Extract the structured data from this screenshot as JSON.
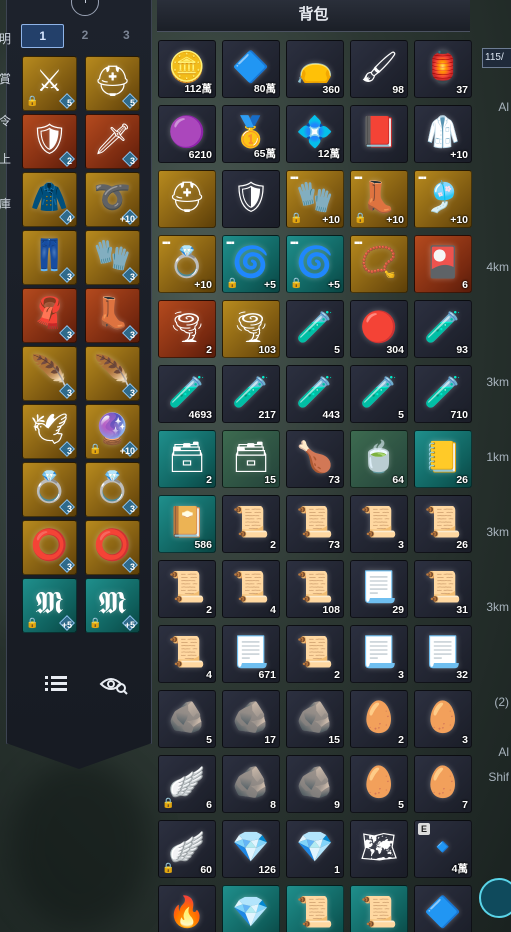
{
  "left": {
    "tabs": [
      {
        "label": "1",
        "active": true
      },
      {
        "label": "2",
        "active": false
      },
      {
        "label": "3",
        "active": false
      }
    ],
    "side_glyphs": [
      "明",
      "賞",
      "令",
      "上",
      "庫"
    ],
    "equipment": [
      {
        "icon": "spear-icon",
        "glyph": "⚔",
        "rarity": "gold",
        "gem": "5",
        "lock": true
      },
      {
        "icon": "helmet-icon",
        "glyph": "⛑",
        "rarity": "gold",
        "gem": "5",
        "lock": false
      },
      {
        "icon": "armor-icon",
        "glyph": "🛡",
        "rarity": "red",
        "gem": "2",
        "lock": false
      },
      {
        "icon": "gauntlet-icon",
        "glyph": "🗡",
        "rarity": "red",
        "gem": "3",
        "lock": false
      },
      {
        "icon": "chest-icon",
        "glyph": "🧥",
        "rarity": "gold",
        "gem": "4",
        "lock": false
      },
      {
        "icon": "belt-icon",
        "glyph": "➰",
        "rarity": "gold",
        "gem": "+10",
        "lock": false
      },
      {
        "icon": "pants-icon",
        "glyph": "👖",
        "rarity": "gold",
        "gem": "3",
        "lock": false
      },
      {
        "icon": "glove-icon",
        "glyph": "🧤",
        "rarity": "gold",
        "gem": "3",
        "lock": false
      },
      {
        "icon": "cape-icon",
        "glyph": "🧣",
        "rarity": "red",
        "gem": "3",
        "lock": false
      },
      {
        "icon": "boots-icon",
        "glyph": "👢",
        "rarity": "red",
        "gem": "3",
        "lock": false
      },
      {
        "icon": "wing-accessory-icon",
        "glyph": "🪶",
        "rarity": "gold",
        "gem": "3",
        "lock": false
      },
      {
        "icon": "wing-accessory-icon",
        "glyph": "🪶",
        "rarity": "gold",
        "gem": "3",
        "lock": false
      },
      {
        "icon": "wing-icon",
        "glyph": "🕊",
        "rarity": "gold",
        "gem": "3",
        "lock": false
      },
      {
        "icon": "orb-icon",
        "glyph": "🔮",
        "rarity": "gold",
        "gem": "+10",
        "lock": true
      },
      {
        "icon": "ring-icon",
        "glyph": "💍",
        "rarity": "gold",
        "gem": "3",
        "lock": false
      },
      {
        "icon": "ring-icon",
        "glyph": "💍",
        "rarity": "gold",
        "gem": "3",
        "lock": false
      },
      {
        "icon": "bracelet-icon",
        "glyph": "⭕",
        "rarity": "gold",
        "gem": "3",
        "lock": false
      },
      {
        "icon": "bracelet-icon",
        "glyph": "⭕",
        "rarity": "gold",
        "gem": "3",
        "lock": false
      },
      {
        "icon": "rune-icon",
        "glyph": "𝕸",
        "rarity": "teal",
        "gem": "+5",
        "lock": true
      },
      {
        "icon": "rune-icon",
        "glyph": "𝕸",
        "rarity": "teal",
        "gem": "+5",
        "lock": true
      }
    ]
  },
  "bag": {
    "title": "背包",
    "items": [
      {
        "icon": "gold-coin-icon",
        "glyph": "🪙",
        "rarity": "dark",
        "count": "112萬"
      },
      {
        "icon": "blue-coin-icon",
        "glyph": "🔷",
        "rarity": "dark",
        "count": "80萬"
      },
      {
        "icon": "pouch-icon",
        "glyph": "👝",
        "rarity": "dark",
        "count": "360"
      },
      {
        "icon": "brush-icon",
        "glyph": "🖌",
        "rarity": "dark",
        "count": "98"
      },
      {
        "icon": "lamp-icon",
        "glyph": "🏮",
        "rarity": "dark",
        "count": "37"
      },
      {
        "icon": "purple-coin-icon",
        "glyph": "🟣",
        "rarity": "dark",
        "count": "6210"
      },
      {
        "icon": "gold-shield-coin-icon",
        "glyph": "🥇",
        "rarity": "dark",
        "count": "65萬"
      },
      {
        "icon": "crystal-coin-icon",
        "glyph": "💠",
        "rarity": "dark",
        "count": "12萬"
      },
      {
        "icon": "red-book-icon",
        "glyph": "📕",
        "rarity": "dark",
        "count": ""
      },
      {
        "icon": "white-armor-icon",
        "glyph": "🥼",
        "rarity": "dark",
        "count": "+10"
      },
      {
        "icon": "helmet-icon",
        "glyph": "⛑",
        "rarity": "gold",
        "count": ""
      },
      {
        "icon": "chest-armor-icon",
        "glyph": "🛡",
        "rarity": "dark",
        "count": ""
      },
      {
        "icon": "gauntlet-icon",
        "glyph": "🧤",
        "rarity": "gold",
        "count": "+10",
        "lock": true,
        "dots": true
      },
      {
        "icon": "boots-icon",
        "glyph": "👢",
        "rarity": "gold",
        "count": "+10",
        "lock": true,
        "dots": true
      },
      {
        "icon": "earring-icon",
        "glyph": "🎐",
        "rarity": "gold",
        "count": "+10",
        "dots": true
      },
      {
        "icon": "ring-icon",
        "glyph": "💍",
        "rarity": "gold",
        "count": "+10",
        "dots": true
      },
      {
        "icon": "rune-stone-icon",
        "glyph": "🌀",
        "rarity": "teal",
        "count": "+5",
        "lock": true,
        "dots": true
      },
      {
        "icon": "rune-stone-icon",
        "glyph": "🌀",
        "rarity": "teal",
        "count": "+5",
        "lock": true,
        "dots": true
      },
      {
        "icon": "amulet-icon",
        "glyph": "📿",
        "rarity": "gold",
        "count": "",
        "dots": true
      },
      {
        "icon": "gold-card-icon",
        "glyph": "🎴",
        "rarity": "red",
        "count": "6"
      },
      {
        "icon": "scroll-swirl-icon",
        "glyph": "🌪",
        "rarity": "red",
        "count": "2"
      },
      {
        "icon": "scroll-swirl-icon",
        "glyph": "🌪",
        "rarity": "gold",
        "count": "103"
      },
      {
        "icon": "yellow-potion-icon",
        "glyph": "🧪",
        "rarity": "dark",
        "count": "5"
      },
      {
        "icon": "red-orb-icon",
        "glyph": "🔴",
        "rarity": "dark",
        "count": "304"
      },
      {
        "icon": "red-potion-icon",
        "glyph": "🧪",
        "rarity": "dark",
        "count": "93"
      },
      {
        "icon": "red-potion-icon",
        "glyph": "🧪",
        "rarity": "dark",
        "count": "4693"
      },
      {
        "icon": "red-potion-icon",
        "glyph": "🧪",
        "rarity": "dark",
        "count": "217"
      },
      {
        "icon": "red-potion-icon",
        "glyph": "🧪",
        "rarity": "dark",
        "count": "443"
      },
      {
        "icon": "red-potion-icon",
        "glyph": "🧪",
        "rarity": "dark",
        "count": "5"
      },
      {
        "icon": "blue-potion-icon",
        "glyph": "🧪",
        "rarity": "dark",
        "count": "710"
      },
      {
        "icon": "chest-icon",
        "glyph": "🗃",
        "rarity": "teal",
        "count": "2"
      },
      {
        "icon": "chest-icon",
        "glyph": "🗃",
        "rarity": "green",
        "count": "15"
      },
      {
        "icon": "roast-meat-icon",
        "glyph": "🍗",
        "rarity": "dark",
        "count": "73"
      },
      {
        "icon": "soup-bowl-icon",
        "glyph": "🍵",
        "rarity": "green",
        "count": "64"
      },
      {
        "icon": "gold-book-icon",
        "glyph": "📒",
        "rarity": "teal",
        "count": "26"
      },
      {
        "icon": "dark-book-icon",
        "glyph": "📔",
        "rarity": "teal",
        "count": "586"
      },
      {
        "icon": "blue-scroll-icon",
        "glyph": "📜",
        "rarity": "dark",
        "count": "2"
      },
      {
        "icon": "blue-scroll-icon",
        "glyph": "📜",
        "rarity": "dark",
        "count": "73"
      },
      {
        "icon": "blue-scroll-icon",
        "glyph": "📜",
        "rarity": "dark",
        "count": "3"
      },
      {
        "icon": "blue-scroll-icon",
        "glyph": "📜",
        "rarity": "dark",
        "count": "26"
      },
      {
        "icon": "blue-scroll-icon",
        "glyph": "📜",
        "rarity": "dark",
        "count": "2"
      },
      {
        "icon": "blue-scroll-icon",
        "glyph": "📜",
        "rarity": "dark",
        "count": "4"
      },
      {
        "icon": "blue-scroll-icon",
        "glyph": "📜",
        "rarity": "dark",
        "count": "108"
      },
      {
        "icon": "parchment-icon",
        "glyph": "📃",
        "rarity": "dark",
        "count": "29"
      },
      {
        "icon": "blue-scroll-icon",
        "glyph": "📜",
        "rarity": "dark",
        "count": "31"
      },
      {
        "icon": "blue-scroll-icon",
        "glyph": "📜",
        "rarity": "dark",
        "count": "4"
      },
      {
        "icon": "parchment-icon",
        "glyph": "📃",
        "rarity": "dark",
        "count": "671"
      },
      {
        "icon": "blue-scroll-icon",
        "glyph": "📜",
        "rarity": "dark",
        "count": "2"
      },
      {
        "icon": "parchment-icon",
        "glyph": "📃",
        "rarity": "dark",
        "count": "3"
      },
      {
        "icon": "parchment-icon",
        "glyph": "📃",
        "rarity": "dark",
        "count": "32"
      },
      {
        "icon": "gray-stone-icon",
        "glyph": "🪨",
        "rarity": "dark",
        "count": "5"
      },
      {
        "icon": "gray-stone-icon",
        "glyph": "🪨",
        "rarity": "dark",
        "count": "17"
      },
      {
        "icon": "gray-stone-icon",
        "glyph": "🪨",
        "rarity": "dark",
        "count": "15"
      },
      {
        "icon": "amber-stone-icon",
        "glyph": "🥚",
        "rarity": "dark",
        "count": "2"
      },
      {
        "icon": "amber-stone-icon",
        "glyph": "🥚",
        "rarity": "dark",
        "count": "3"
      },
      {
        "icon": "winged-stone-icon",
        "glyph": "🪽",
        "rarity": "dark",
        "count": "6",
        "lock": true
      },
      {
        "icon": "gray-stone-icon",
        "glyph": "🪨",
        "rarity": "dark",
        "count": "8"
      },
      {
        "icon": "gray-stone-icon",
        "glyph": "🪨",
        "rarity": "dark",
        "count": "9"
      },
      {
        "icon": "amber-stone-icon",
        "glyph": "🥚",
        "rarity": "dark",
        "count": "5"
      },
      {
        "icon": "amber-stone-icon",
        "glyph": "🥚",
        "rarity": "dark",
        "count": "7"
      },
      {
        "icon": "winged-stone-icon",
        "glyph": "🪽",
        "rarity": "dark",
        "count": "60",
        "lock": true
      },
      {
        "icon": "crystal-icon",
        "glyph": "💎",
        "rarity": "dark",
        "count": "126"
      },
      {
        "icon": "crystal-icon",
        "glyph": "💎",
        "rarity": "dark",
        "count": "1"
      },
      {
        "icon": "map-card-icon",
        "glyph": "🗺",
        "rarity": "dark",
        "count": ""
      },
      {
        "icon": "blue-shard-icon",
        "glyph": "🔹",
        "rarity": "dark",
        "count": "4萬",
        "eq": "E"
      },
      {
        "icon": "flame-icon",
        "glyph": "🔥",
        "rarity": "dark",
        "count": ""
      },
      {
        "icon": "blue-crystal-icon",
        "glyph": "💎",
        "rarity": "teal",
        "count": ""
      },
      {
        "icon": "scroll-roll-icon",
        "glyph": "📜",
        "rarity": "teal",
        "count": ""
      },
      {
        "icon": "scroll-roll-icon",
        "glyph": "📜",
        "rarity": "teal",
        "count": ""
      },
      {
        "icon": "blue-gem-icon",
        "glyph": "🔷",
        "rarity": "dark",
        "count": ""
      }
    ]
  },
  "right": {
    "capacity": "115/",
    "labels": [
      "Al",
      "4km",
      "3km",
      "1km",
      "3km",
      "3km",
      "(2)",
      "Al",
      "Shif"
    ]
  }
}
